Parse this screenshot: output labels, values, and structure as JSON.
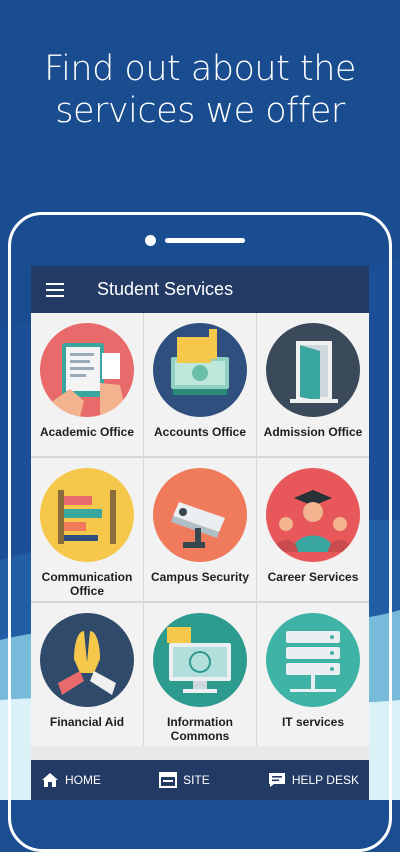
{
  "promo": {
    "line1": "Find out about the",
    "line2": "services we offer"
  },
  "appbar": {
    "title": "Student Services",
    "menu_icon": "hamburger-menu-icon"
  },
  "services": [
    {
      "label": "Academic Office",
      "icon": "academic-office-icon",
      "color": "#e86a6a"
    },
    {
      "label": "Accounts Office",
      "icon": "accounts-office-icon",
      "color": "#2f4f7f"
    },
    {
      "label": "Admission Office",
      "icon": "admission-office-icon",
      "color": "#3a4a5a"
    },
    {
      "label": "Communication Office",
      "icon": "communication-office-icon",
      "color": "#f5c84c"
    },
    {
      "label": "Campus Security",
      "icon": "campus-security-icon",
      "color": "#f07a5c"
    },
    {
      "label": "Career Services",
      "icon": "career-services-icon",
      "color": "#e8575a"
    },
    {
      "label": "Financial Aid",
      "icon": "financial-aid-icon",
      "color": "#2f4a6a"
    },
    {
      "label": "Information Commons",
      "icon": "information-commons-icon",
      "color": "#2c9b8e"
    },
    {
      "label": "IT services",
      "icon": "it-services-icon",
      "color": "#3fb3a6"
    }
  ],
  "bottom_nav": {
    "home": "HOME",
    "site": "SITE",
    "help_desk": "HELP DESK"
  },
  "colors": {
    "background": "#1a4d90",
    "appbar": "#233a65",
    "grid_bg": "#f2f2f2"
  }
}
